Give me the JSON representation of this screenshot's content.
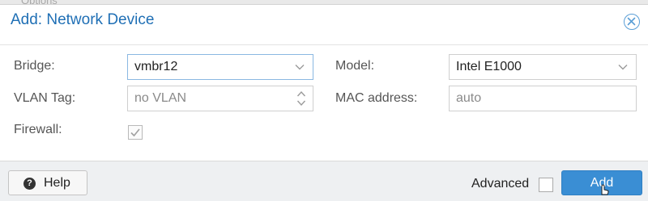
{
  "background_strip": {
    "text": "Options"
  },
  "dialog": {
    "title": "Add: Network Device",
    "close_icon": "close-circle-icon"
  },
  "form": {
    "bridge": {
      "label": "Bridge:",
      "value": "vmbr12"
    },
    "vlan_tag": {
      "label": "VLAN Tag:",
      "placeholder": "no VLAN"
    },
    "firewall": {
      "label": "Firewall:",
      "checked": true
    },
    "model": {
      "label": "Model:",
      "value": "Intel E1000"
    },
    "mac_address": {
      "label": "MAC address:",
      "placeholder": "auto"
    }
  },
  "footer": {
    "help_label": "Help",
    "advanced_label": "Advanced",
    "advanced_checked": false,
    "add_label": "Add"
  },
  "colors": {
    "title": "#1f6fb5",
    "primary_button": "#3a8ed4",
    "footer_bg": "#eef0f2"
  }
}
